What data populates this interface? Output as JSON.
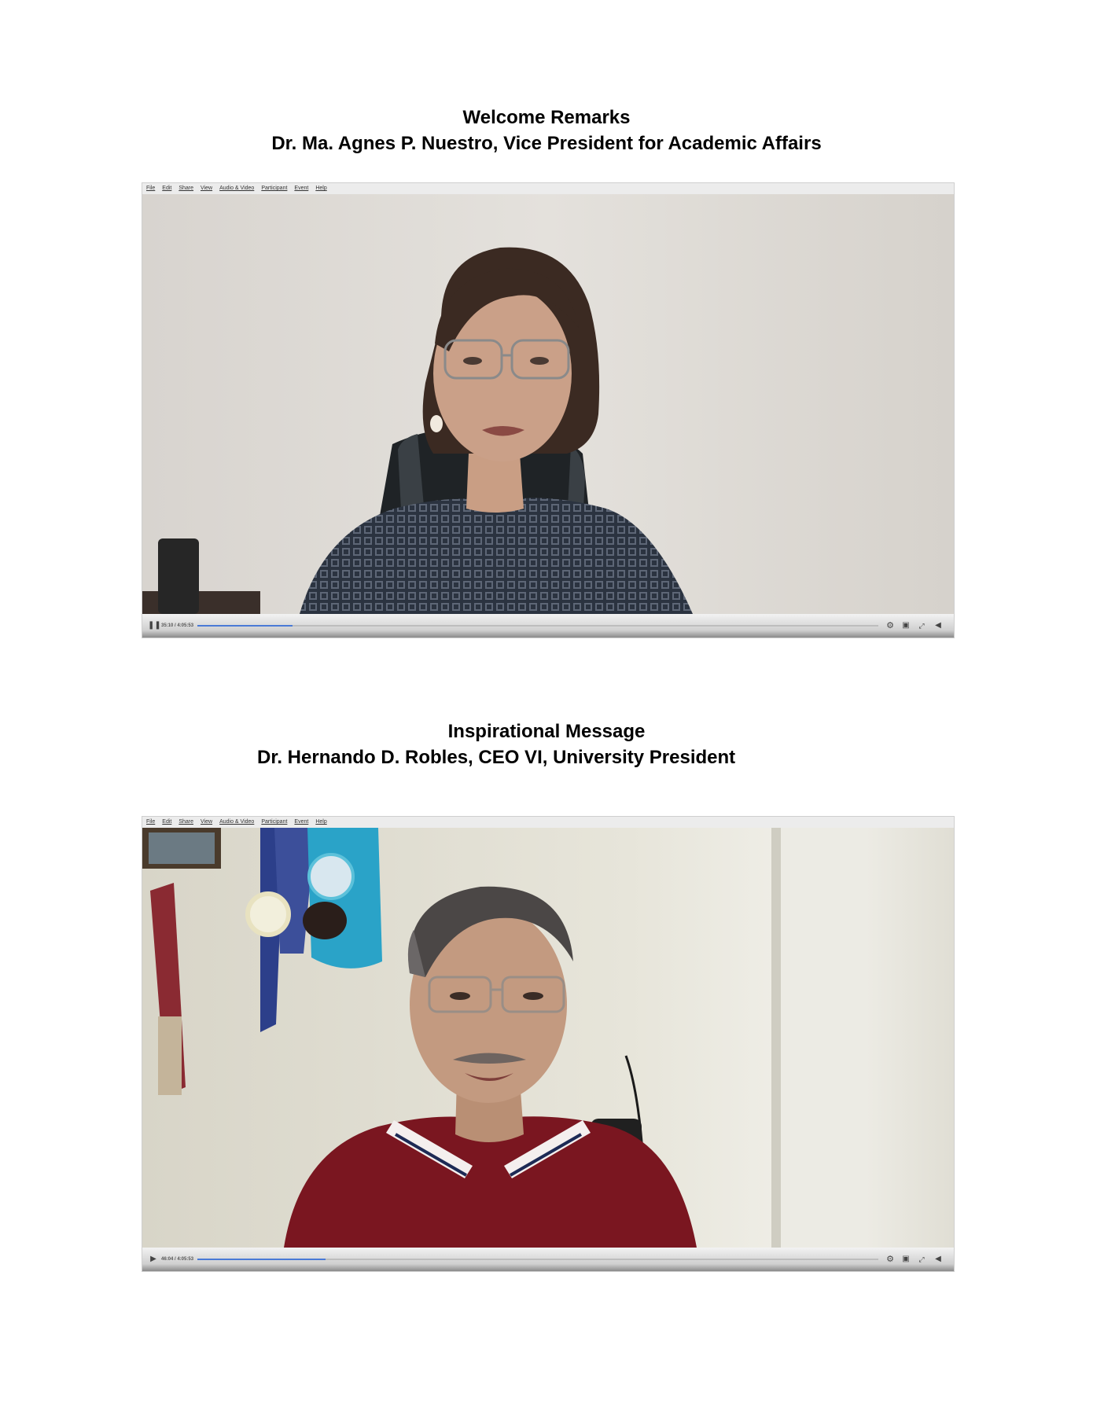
{
  "sections": [
    {
      "title": "Welcome Remarks",
      "speaker": "Dr. Ma. Agnes P. Nuestro, Vice President for Academic Affairs",
      "player": {
        "menu": [
          "File",
          "Edit",
          "Share",
          "View",
          "Audio & Video",
          "Participant",
          "Event",
          "Help"
        ],
        "timecode": "35:10 / 4:05:53",
        "progress": 0.14,
        "play_state": "pause-icon"
      }
    },
    {
      "title": "Inspirational Message",
      "speaker": "Dr. Hernando D. Robles, CEO VI, University President",
      "player": {
        "menu": [
          "File",
          "Edit",
          "Share",
          "View",
          "Audio & Video",
          "Participant",
          "Event",
          "Help"
        ],
        "timecode": "46:04 / 4:05:53",
        "progress": 0.188,
        "play_state": "play-icon"
      }
    }
  ]
}
